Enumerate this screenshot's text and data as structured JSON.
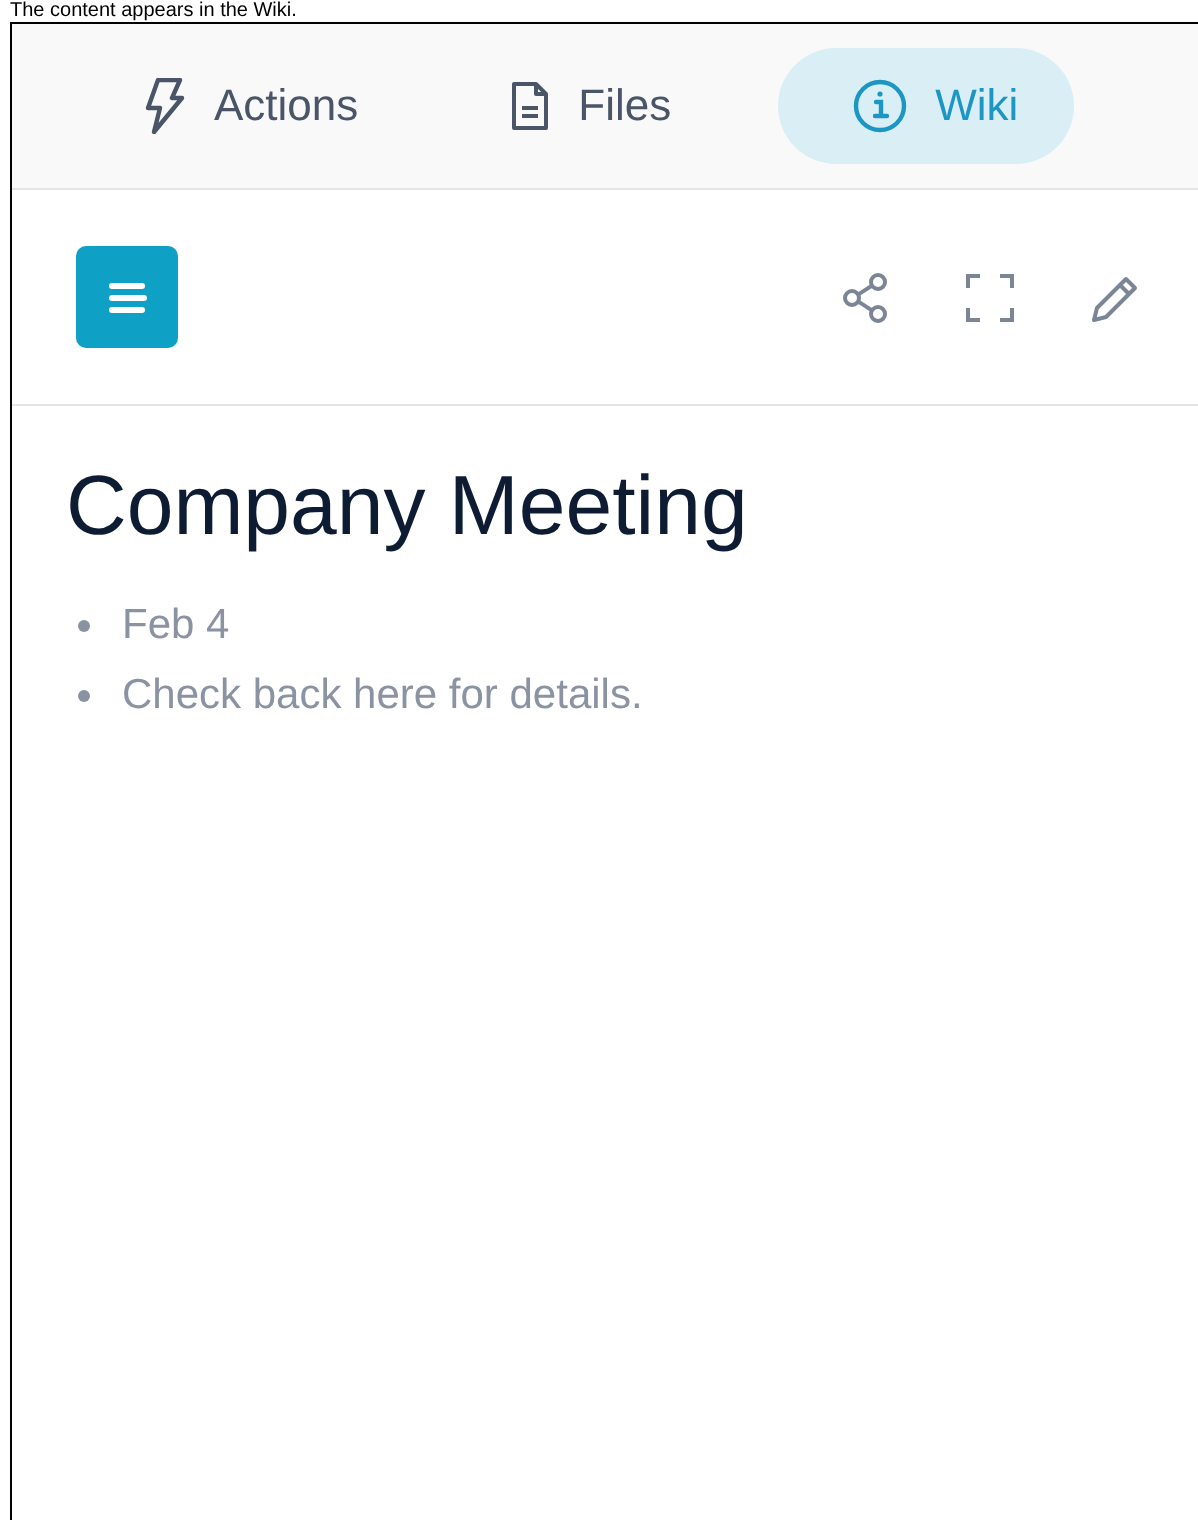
{
  "caption": "The content appears in the Wiki.",
  "tabs": [
    {
      "label": "Actions",
      "selected": false
    },
    {
      "label": "Files",
      "selected": false
    },
    {
      "label": "Wiki",
      "selected": true
    }
  ],
  "page": {
    "title": "Company Meeting",
    "items": [
      "Feb 4",
      "Check back here for details."
    ]
  }
}
